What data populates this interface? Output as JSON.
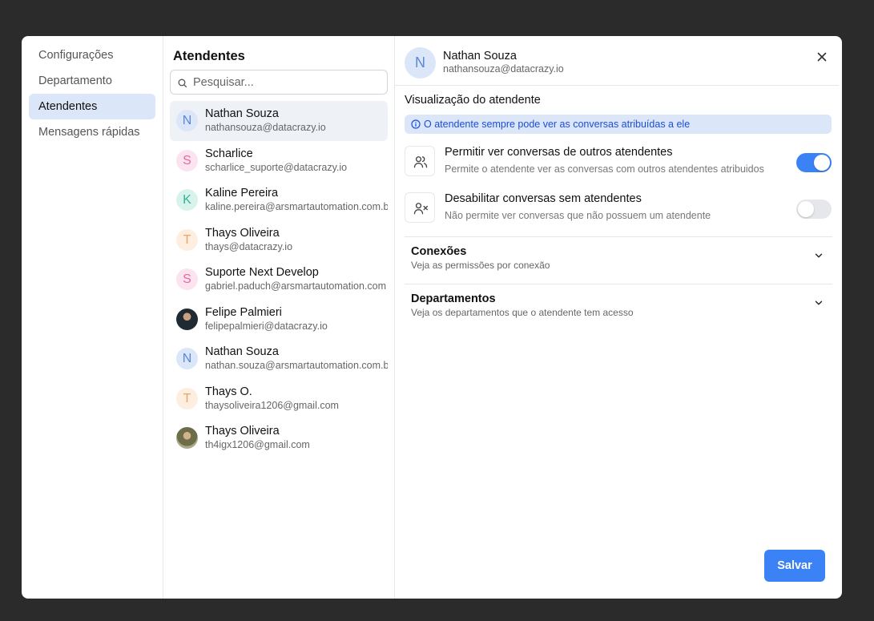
{
  "nav": {
    "items": [
      {
        "label": "Configurações",
        "active": false
      },
      {
        "label": "Departamento",
        "active": false
      },
      {
        "label": "Atendentes",
        "active": true
      },
      {
        "label": "Mensagens rápidas",
        "active": false
      }
    ]
  },
  "attendants": {
    "title": "Atendentes",
    "search_placeholder": "Pesquisar...",
    "items": [
      {
        "initial": "N",
        "name": "Nathan Souza",
        "email": "nathansouza@datacrazy.io",
        "avatar": "blue"
      },
      {
        "initial": "S",
        "name": "Scharlice",
        "email": "scharlice_suporte@datacrazy.io",
        "avatar": "pink"
      },
      {
        "initial": "K",
        "name": "Kaline Pereira",
        "email": "kaline.pereira@arsmartautomation.com.br",
        "avatar": "teal"
      },
      {
        "initial": "T",
        "name": "Thays Oliveira",
        "email": "thays@datacrazy.io",
        "avatar": "orange"
      },
      {
        "initial": "S",
        "name": "Suporte Next Develop",
        "email": "gabriel.paduch@arsmartautomation.com",
        "avatar": "pink"
      },
      {
        "initial": "",
        "name": "Felipe Palmieri",
        "email": "felipepalmieri@datacrazy.io",
        "avatar": "photo"
      },
      {
        "initial": "N",
        "name": "Nathan Souza",
        "email": "nathan.souza@arsmartautomation.com.br",
        "avatar": "blue"
      },
      {
        "initial": "T",
        "name": "Thays O.",
        "email": "thaysoliveira1206@gmail.com",
        "avatar": "orange"
      },
      {
        "initial": "",
        "name": "Thays Oliveira",
        "email": "th4igx1206@gmail.com",
        "avatar": "photo"
      }
    ]
  },
  "detail": {
    "initial": "N",
    "name": "Nathan Souza",
    "email": "nathansouza@datacrazy.io",
    "section_title": "Visualização do atendente",
    "info_text": "O atendente sempre pode ver as conversas atribuídas a ele",
    "permissions": [
      {
        "title": "Permitir ver conversas de outros atendentes",
        "description": "Permite o atendente ver as conversas com outros atendentes atribuidos",
        "enabled": true,
        "icon": "users-icon"
      },
      {
        "title": "Desabilitar conversas sem atendentes",
        "description": "Não permite ver conversas que não possuem um atendente",
        "enabled": false,
        "icon": "user-x-icon"
      }
    ],
    "accordions": [
      {
        "title": "Conexões",
        "subtitle": "Veja as permissões por conexão"
      },
      {
        "title": "Departamentos",
        "subtitle": "Veja os departamentos que o atendente tem acesso"
      }
    ],
    "save_label": "Salvar"
  },
  "colors": {
    "accent": "#3b82f6",
    "nav_active_bg": "#dbe6f8",
    "info_bg": "#dbe6f8",
    "info_text": "#1d4ed8",
    "backdrop": "#2b2b2b"
  }
}
